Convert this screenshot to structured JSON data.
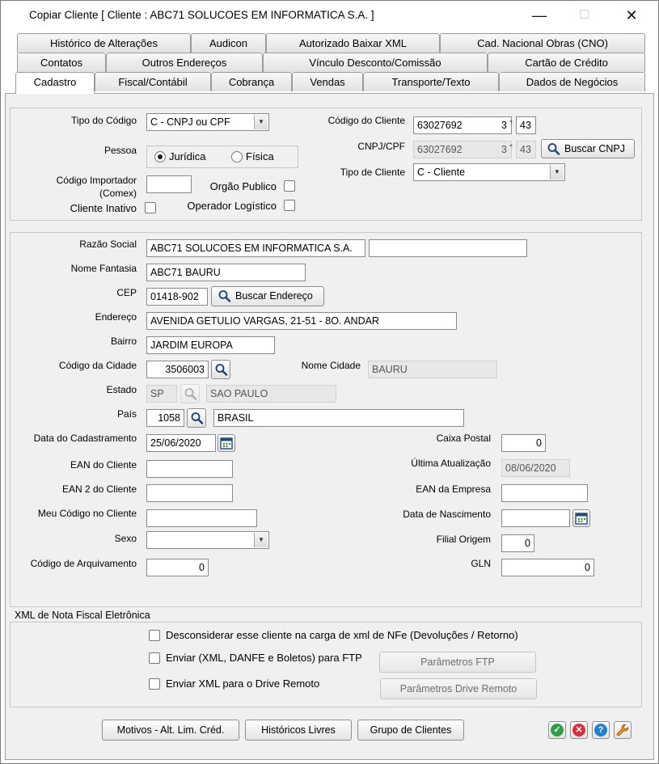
{
  "window": {
    "title": "Copiar Cliente [ Cliente : ABC71 SOLUCOES EM INFORMATICA S.A. ]",
    "minimize": "—",
    "maximize": "☐",
    "close": "✕"
  },
  "tabs": {
    "row1": [
      "Histórico de Alterações",
      "Audicon",
      "Autorizado Baixar XML",
      "Cad. Nacional Obras (CNO)"
    ],
    "row2": [
      "Contatos",
      "Outros Endereços",
      "Vínculo Desconto/Comissão",
      "Cartão de Crédito"
    ],
    "row3": [
      "Cadastro",
      "Fiscal/Contábil",
      "Cobrança",
      "Vendas",
      "Transporte/Texto",
      "Dados de Negócios"
    ],
    "active": "Cadastro"
  },
  "identificacao": {
    "tipo_codigo_label": "Tipo do Código",
    "tipo_codigo_value": "C - CNPJ ou CPF",
    "pessoa_label": "Pessoa",
    "juridica_label": "Jurídica",
    "fisica_label": "Física",
    "pessoa_selected": "Jurídica",
    "codigo_importador_label": "Código Importador",
    "comex_label": "(Comex)",
    "codigo_importador_value": "",
    "cliente_inativo_label": "Cliente Inativo",
    "orgao_publico_label": "Orgão Publico",
    "operador_logistico_label": "Operador Logístico",
    "codigo_cliente_label": "Código do Cliente",
    "codigo_cliente_value": "63027692",
    "codigo_cliente_filial": "3",
    "codigo_cliente_dv": "43",
    "cnpj_label": "CNPJ/CPF",
    "cnpj_value": "63027692",
    "cnpj_filial": "3",
    "cnpj_dv": "43",
    "hyphen": "-",
    "buscar_cnpj_label": "Buscar CNPJ",
    "tipo_cliente_label": "Tipo de Cliente",
    "tipo_cliente_value": "C - Cliente"
  },
  "dados": {
    "razao_social_label": "Razão Social",
    "razao_social_value": "ABC71 SOLUCOES EM INFORMATICA S.A.",
    "razao_social_complemento": "",
    "nome_fantasia_label": "Nome Fantasia",
    "nome_fantasia_value": "ABC71 BAURU",
    "cep_label": "CEP",
    "cep_value": "01418-902",
    "buscar_endereco_label": "Buscar Endereço",
    "endereco_label": "Endereço",
    "endereco_value": "AVENIDA GETULIO VARGAS, 21-51 - 8O. ANDAR",
    "bairro_label": "Bairro",
    "bairro_value": "JARDIM EUROPA",
    "codigo_cidade_label": "Código da Cidade",
    "codigo_cidade_value": "3506003",
    "nome_cidade_label": "Nome Cidade",
    "nome_cidade_value": "BAURU",
    "estado_label": "Estado",
    "estado_sigla": "SP",
    "estado_nome": "SAO PAULO",
    "pais_label": "País",
    "pais_codigo": "1058",
    "pais_nome": "BRASIL",
    "data_cadastramento_label": "Data do Cadastramento",
    "data_cadastramento_value": "25/06/2020",
    "caixa_postal_label": "Caixa Postal",
    "caixa_postal_value": "0",
    "ean_cliente_label": "EAN do Cliente",
    "ean_cliente_value": "",
    "ultima_atualizacao_label": "Última Atualização",
    "ultima_atualizacao_value": "08/06/2020",
    "ean2_cliente_label": "EAN 2 do Cliente",
    "ean2_cliente_value": "",
    "ean_empresa_label": "EAN da Empresa",
    "ean_empresa_value": "",
    "meu_codigo_label": "Meu Código no Cliente",
    "meu_codigo_value": "",
    "data_nascimento_label": "Data de Nascimento",
    "data_nascimento_value": "",
    "sexo_label": "Sexo",
    "sexo_value": "",
    "filial_origem_label": "Filial Origem",
    "filial_origem_value": "0",
    "codigo_arquivamento_label": "Código de Arquivamento",
    "codigo_arquivamento_value": "0",
    "gln_label": "GLN",
    "gln_value": "0"
  },
  "xml": {
    "group_label": "XML de Nota Fiscal Eletrônica",
    "desconsiderar_label": "Desconsiderar esse cliente na carga de xml de NFe (Devoluções / Retorno)",
    "enviar_ftp_label": "Enviar (XML, DANFE e Boletos) para FTP",
    "parametros_ftp_label": "Parâmetros FTP",
    "enviar_drive_label": "Enviar XML para o Drive Remoto",
    "parametros_drive_label": "Parâmetros Drive Remoto"
  },
  "footer": {
    "motivos_label": "Motivos - Alt. Lim. Créd.",
    "historicos_label": "Históricos Livres",
    "grupo_label": "Grupo de Clientes"
  },
  "colors": {
    "ok": "#2ea043",
    "cancel": "#d9303a",
    "help": "#1e7fd6",
    "tools": "#f0921e"
  }
}
